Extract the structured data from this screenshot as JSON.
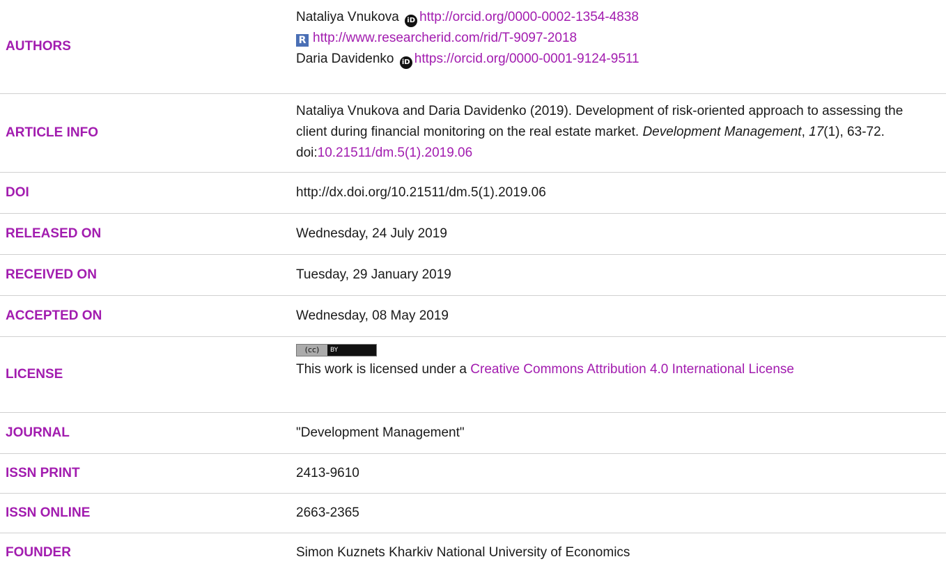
{
  "rows": {
    "authors": {
      "label": "AUTHORS",
      "author1_name": "Nataliya Vnukova",
      "author1_orcid": "http://orcid.org/0000-0002-1354-4838",
      "author1_researcherid": "http://www.researcherid.com/rid/T-9097-2018",
      "author2_name": "Daria Davidenko",
      "author2_orcid": "https://orcid.org/0000-0001-9124-9511"
    },
    "article_info": {
      "label": "ARTICLE INFO",
      "citation_text": "Nataliya Vnukova and Daria Davidenko (2019). Development of risk-oriented approach to assessing the client during financial monitoring on the real estate market. ",
      "journal_italic": "Development Management",
      "sep1": ", ",
      "volume_italic": "17",
      "issue_pages": "(1), 63-72. doi:",
      "doi_link": "10.21511/dm.5(1).2019.06"
    },
    "doi": {
      "label": "DOI",
      "value": "http://dx.doi.org/10.21511/dm.5(1).2019.06"
    },
    "released_on": {
      "label": "RELEASED ON",
      "value": "Wednesday, 24 July 2019"
    },
    "received_on": {
      "label": "RECEIVED ON",
      "value": "Tuesday, 29 January 2019"
    },
    "accepted_on": {
      "label": "ACCEPTED ON",
      "value": "Wednesday, 08 May 2019"
    },
    "license": {
      "label": "LICENSE",
      "badge_cc": "(cc)",
      "badge_by": "BY",
      "text_before": "This work is licensed under a ",
      "link_text": "Creative Commons Attribution 4.0 International License"
    },
    "journal": {
      "label": "JOURNAL",
      "value": "\"Development Management\""
    },
    "issn_print": {
      "label": "ISSN PRINT",
      "value": "2413-9610"
    },
    "issn_online": {
      "label": "ISSN ONLINE",
      "value": "2663-2365"
    },
    "founder": {
      "label": "FOUNDER",
      "value": "Simon Kuznets Kharkiv National University of Economics"
    }
  },
  "icons": {
    "orcid": "orcid-icon",
    "researcherid": "researcherid-icon",
    "cc_license": "cc-by-badge"
  },
  "colors": {
    "label": "#a21caf",
    "link": "#a21caf",
    "text": "#1a1a1a",
    "divider": "#d0d0d0"
  }
}
